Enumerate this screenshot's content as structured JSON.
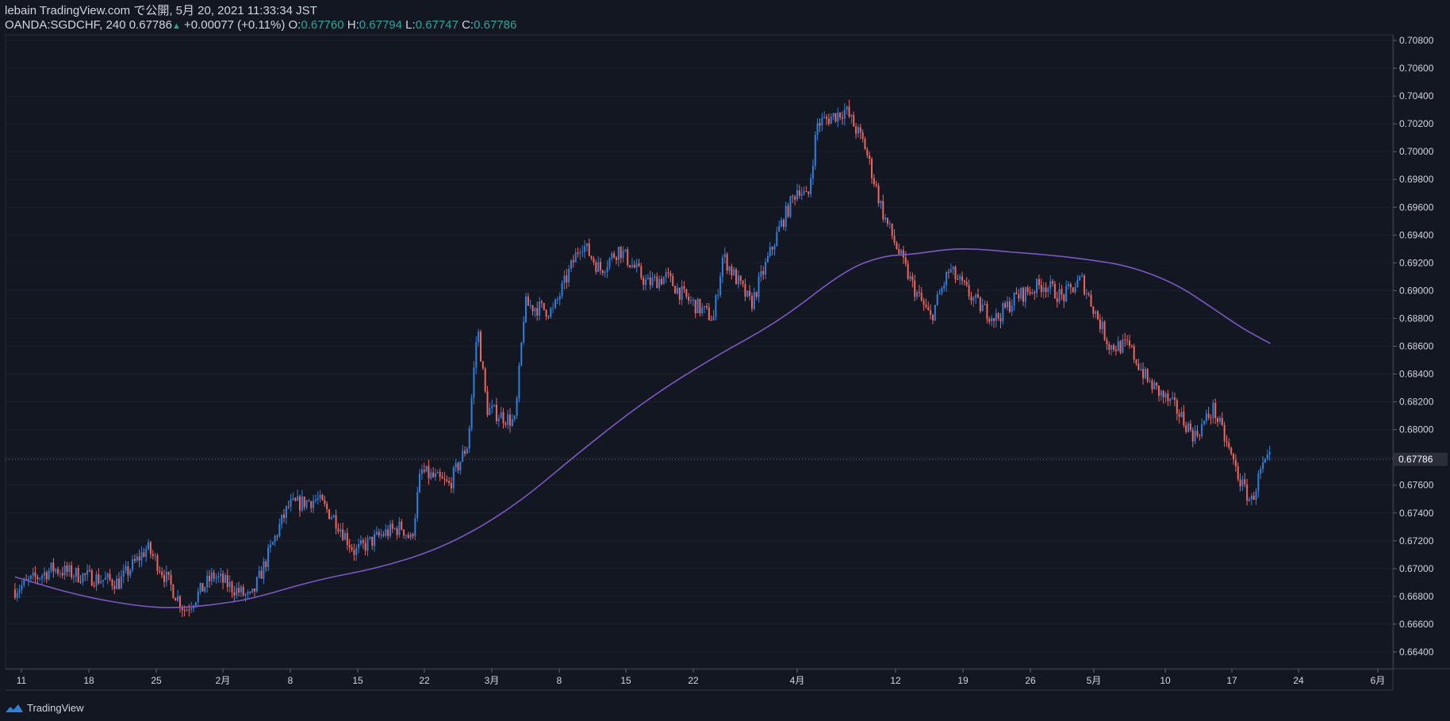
{
  "header": {
    "publisher": "lebain TradingView.com で公開, 5月 20, 2021 11:33:34 JST",
    "symbol": "OANDA:SGDCHF, 240",
    "last": "0.67786",
    "change": "+0.00077 (+0.11%)",
    "o_label": "O:",
    "o_value": "0.67760",
    "h_label": "H:",
    "h_value": "0.67794",
    "l_label": "L:",
    "l_value": "0.67747",
    "c_label": "C:",
    "c_value": "0.67786"
  },
  "footer": {
    "brand": "TradingView",
    "icon": "tradingview-logo-icon"
  },
  "colors": {
    "background": "#131722",
    "up": "#2f80db",
    "down": "#f0655d",
    "ma": "#7e57c2",
    "price_tag_bg": "#2a2e39",
    "grid": "#1e2230"
  },
  "chart_data": {
    "type": "candlestick",
    "ylim": [
      0.6628,
      0.7084
    ],
    "y_ticks": [
      "0.66400",
      "0.66600",
      "0.66800",
      "0.67000",
      "0.67200",
      "0.67400",
      "0.67600",
      "0.67800",
      "0.68000",
      "0.68200",
      "0.68400",
      "0.68600",
      "0.68800",
      "0.69000",
      "0.69200",
      "0.69400",
      "0.69600",
      "0.69800",
      "0.70000",
      "0.70200",
      "0.70400",
      "0.70600",
      "0.70800"
    ],
    "x_ticks": [
      "11",
      "18",
      "25",
      "2月",
      "8",
      "15",
      "22",
      "3月",
      "8",
      "15",
      "22",
      "4月",
      "12",
      "19",
      "26",
      "5月",
      "10",
      "17",
      "24",
      "6月"
    ],
    "current_price_label": "0.67786",
    "price_series": {
      "name": "SGDCHF",
      "x": [
        "2021-01-07",
        "2021-01-11",
        "2021-01-14",
        "2021-01-18",
        "2021-01-21",
        "2021-01-22",
        "2021-01-25",
        "2021-01-28",
        "2021-02-01",
        "2021-02-04",
        "2021-02-05",
        "2021-02-08",
        "2021-02-10",
        "2021-02-12",
        "2021-02-15",
        "2021-02-17",
        "2021-02-18",
        "2021-02-19",
        "2021-02-22",
        "2021-02-24",
        "2021-02-25",
        "2021-02-26",
        "2021-03-01",
        "2021-03-02",
        "2021-03-05",
        "2021-03-08",
        "2021-03-10",
        "2021-03-12",
        "2021-03-15",
        "2021-03-17",
        "2021-03-19",
        "2021-03-22",
        "2021-03-23",
        "2021-03-26",
        "2021-03-29",
        "2021-03-31",
        "2021-04-01",
        "2021-04-02",
        "2021-04-05",
        "2021-04-07",
        "2021-04-09",
        "2021-04-12",
        "2021-04-14",
        "2021-04-16",
        "2021-04-19",
        "2021-04-21",
        "2021-04-23",
        "2021-04-26",
        "2021-04-28",
        "2021-04-30",
        "2021-05-03",
        "2021-05-05",
        "2021-05-07",
        "2021-05-10",
        "2021-05-12",
        "2021-05-14",
        "2021-05-17",
        "2021-05-18",
        "2021-05-19",
        "2021-05-20"
      ],
      "y": [
        0.6685,
        0.67,
        0.6695,
        0.669,
        0.6715,
        0.6705,
        0.667,
        0.6695,
        0.6678,
        0.673,
        0.6745,
        0.675,
        0.6735,
        0.6712,
        0.6725,
        0.673,
        0.672,
        0.677,
        0.676,
        0.679,
        0.6875,
        0.6815,
        0.6805,
        0.689,
        0.6885,
        0.6935,
        0.6915,
        0.693,
        0.6905,
        0.691,
        0.6895,
        0.688,
        0.6925,
        0.689,
        0.6945,
        0.6975,
        0.6965,
        0.702,
        0.703,
        0.7005,
        0.6955,
        0.6905,
        0.688,
        0.6915,
        0.689,
        0.688,
        0.6895,
        0.6905,
        0.6895,
        0.6908,
        0.686,
        0.686,
        0.6835,
        0.6815,
        0.6795,
        0.6815,
        0.676,
        0.6748,
        0.677,
        0.6779
      ]
    },
    "ma_series": {
      "x": [
        "2021-01-07",
        "2021-01-14",
        "2021-01-21",
        "2021-01-25",
        "2021-01-28",
        "2021-02-01",
        "2021-02-08",
        "2021-02-15",
        "2021-02-22",
        "2021-03-01",
        "2021-03-08",
        "2021-03-15",
        "2021-03-22",
        "2021-03-29",
        "2021-04-05",
        "2021-04-09",
        "2021-04-12",
        "2021-04-16",
        "2021-04-19",
        "2021-04-22",
        "2021-04-26",
        "2021-04-30",
        "2021-05-05",
        "2021-05-10",
        "2021-05-14",
        "2021-05-17",
        "2021-05-20"
      ],
      "y": [
        0.6694,
        0.668,
        0.6672,
        0.6672,
        0.6674,
        0.6678,
        0.6692,
        0.6701,
        0.6717,
        0.6745,
        0.6785,
        0.6822,
        0.6852,
        0.6878,
        0.6915,
        0.6925,
        0.6926,
        0.693,
        0.693,
        0.6928,
        0.6926,
        0.6923,
        0.6918,
        0.6905,
        0.6887,
        0.6873,
        0.6862
      ]
    }
  }
}
